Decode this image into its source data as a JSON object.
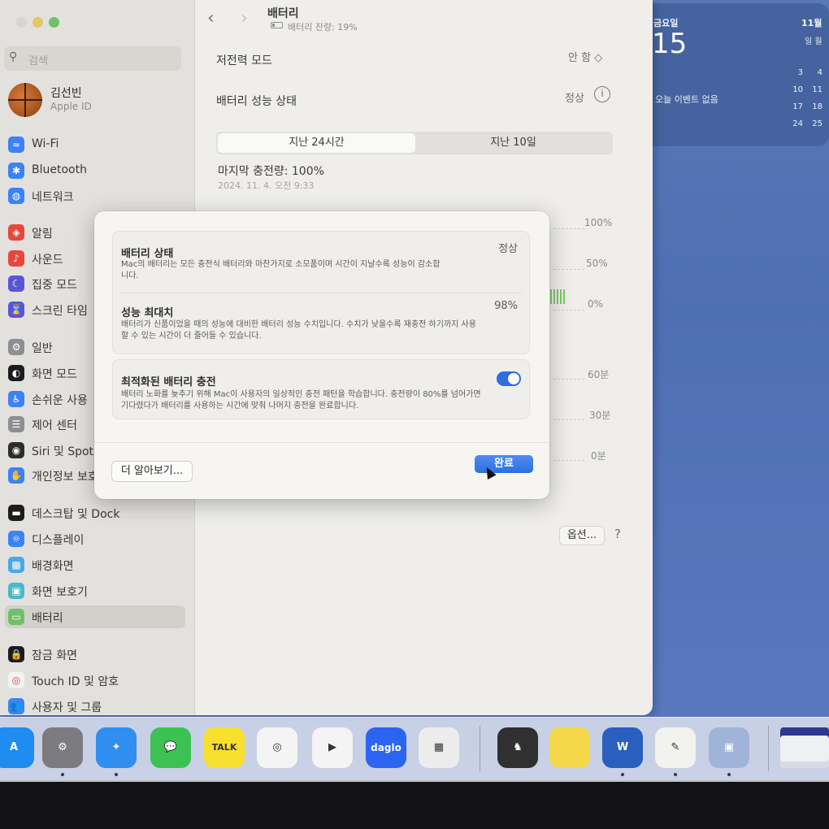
{
  "colors": {
    "accent": "#2f6de1",
    "battery_green": "#7ec86b",
    "desktop": "#5878b8"
  },
  "sidebar": {
    "search_placeholder": "검색",
    "user": {
      "name": "김선빈",
      "subtitle": "Apple ID"
    },
    "items": [
      {
        "label": "Wi-Fi",
        "icon": "wifi-icon",
        "color": "#3b82f6"
      },
      {
        "label": "Bluetooth",
        "icon": "bluetooth-icon",
        "color": "#3b82f6"
      },
      {
        "label": "네트워크",
        "icon": "globe-icon",
        "color": "#3b82f6"
      },
      {
        "label": "알림",
        "icon": "bell-icon",
        "color": "#e8473b"
      },
      {
        "label": "사운드",
        "icon": "speaker-icon",
        "color": "#e8473b"
      },
      {
        "label": "집중 모드",
        "icon": "moon-icon",
        "color": "#5a55d6"
      },
      {
        "label": "스크린 타임",
        "icon": "hourglass-icon",
        "color": "#5a55d6"
      },
      {
        "label": "일반",
        "icon": "gear-icon",
        "color": "#8e8e93"
      },
      {
        "label": "화면 모드",
        "icon": "appearance-icon",
        "color": "#1c1c1e"
      },
      {
        "label": "손쉬운 사용",
        "icon": "accessibility-icon",
        "color": "#3b82f6"
      },
      {
        "label": "제어 센터",
        "icon": "control-center-icon",
        "color": "#8e8e93"
      },
      {
        "label": "Siri 및 Spot",
        "icon": "siri-icon",
        "color": "#2c2c2e"
      },
      {
        "label": "개인정보 보호",
        "icon": "hand-icon",
        "color": "#3b82f6"
      },
      {
        "label": "데스크탑 및 Dock",
        "icon": "dock-icon",
        "color": "#1c1c1e"
      },
      {
        "label": "디스플레이",
        "icon": "sun-icon",
        "color": "#3b82f6"
      },
      {
        "label": "배경화면",
        "icon": "wallpaper-icon",
        "color": "#4aa8e8"
      },
      {
        "label": "화면 보호기",
        "icon": "screensaver-icon",
        "color": "#4ab8c8"
      },
      {
        "label": "배터리",
        "icon": "battery-icon",
        "color": "#6fc06a"
      },
      {
        "label": "잠금 화면",
        "icon": "lock-icon",
        "color": "#1c1c1e"
      },
      {
        "label": "Touch ID 및 암호",
        "icon": "fingerprint-icon",
        "color": "#f2f2f2"
      },
      {
        "label": "사용자 및 그룹",
        "icon": "users-icon",
        "color": "#3b82f6"
      }
    ]
  },
  "main": {
    "title": "배터리",
    "subtitle": "배터리 잔량: 19%",
    "low_power_label": "저전력 모드",
    "low_power_value": "안 함 ◇",
    "health_label": "배터리 성능 상태",
    "health_value": "정상",
    "tabs": [
      "지난 24시간",
      "지난 10일"
    ],
    "last_charge": "마지막 충전량: 100%",
    "last_charge_date": "2024. 11. 4. 오전 9:33",
    "level_axis": [
      "100%",
      "50%",
      "0%"
    ],
    "usage_axis": [
      "60분",
      "30분",
      "0분"
    ],
    "options_label": "옵션...",
    "help_label": "?"
  },
  "sheet": {
    "cards": [
      {
        "title": "배터리 상태",
        "value": "정상",
        "desc": "Mac의 배터리는 모든 충전식 배터리와 마찬가지로 소모품이며 시간이 지날수록 성능이 감소합니다."
      },
      {
        "title": "성능 최대치",
        "value": "98%",
        "desc": "배터리가 신품이었을 때의 성능에 대비한 배터리 성능 수치입니다. 수치가 낮을수록 재충전 하기까지 사용할 수 있는 시간이 더 줄어들 수 있습니다."
      },
      {
        "title": "최적화된 배터리 충전",
        "desc": "배터리 노화를 늦추기 위해 Mac이 사용자의 일상적인 충전 패턴을 학습합니다. 충전량이 80%를 넘어가면 기다렸다가 배터리를 사용하는 시간에 맞춰 나머지 충전을 완료합니다.",
        "toggle": true
      }
    ],
    "learn_more": "더 알아보기...",
    "done": "완료"
  },
  "calendar": {
    "weekday": "금요일",
    "date": "15",
    "no_events": "오늘 이벤트 없음",
    "month": "11월",
    "dow": "일 월",
    "numbers": [
      [
        "3",
        "4"
      ],
      [
        "10",
        "11"
      ],
      [
        "17",
        "18"
      ],
      [
        "24",
        "25"
      ]
    ]
  },
  "dock": {
    "apps": [
      {
        "name": "App Store",
        "label": "A",
        "icon": "app-store-icon",
        "color": "#1e8cf0",
        "running": false
      },
      {
        "name": "시스템 설정",
        "label": "⚙",
        "icon": "system-settings-icon",
        "color": "#7c7c80",
        "running": true
      },
      {
        "name": "Safari",
        "label": "✦",
        "icon": "safari-icon",
        "color": "#2f8ff0",
        "running": true
      },
      {
        "name": "메시지",
        "label": "💬",
        "icon": "messages-icon",
        "color": "#3cc252",
        "running": false
      },
      {
        "name": "KakaoTalk",
        "label": "TALK",
        "icon": "kakaotalk-icon",
        "color": "#f7e02e",
        "running": false
      },
      {
        "name": "Naver",
        "label": "◎",
        "icon": "green-circle-app-icon",
        "color": "#f4f4f4",
        "running": false
      },
      {
        "name": "Infuse",
        "label": "▶",
        "icon": "play-icon",
        "color": "#f4f4f4",
        "running": false
      },
      {
        "name": "daglo",
        "label": "daglo",
        "icon": "daglo-icon",
        "color": "#2a64f0",
        "running": false
      },
      {
        "name": "Launchpad",
        "label": "▦",
        "icon": "launchpad-icon",
        "color": "#ececec",
        "running": false
      },
      {
        "name": "Chess",
        "label": "♞",
        "icon": "chess-icon",
        "color": "#303030",
        "running": false
      },
      {
        "name": "메모",
        "label": "",
        "icon": "notes-icon",
        "color": "#f5d84a",
        "running": false
      },
      {
        "name": "Word",
        "label": "W",
        "icon": "word-icon",
        "color": "#2a5fbf",
        "running": true
      },
      {
        "name": "TextEdit",
        "label": "✎",
        "icon": "textedit-icon",
        "color": "#f2f2ee",
        "running": true
      },
      {
        "name": "미리보기",
        "label": "▣",
        "icon": "preview-icon",
        "color": "#9fb4d8",
        "running": true
      }
    ]
  }
}
